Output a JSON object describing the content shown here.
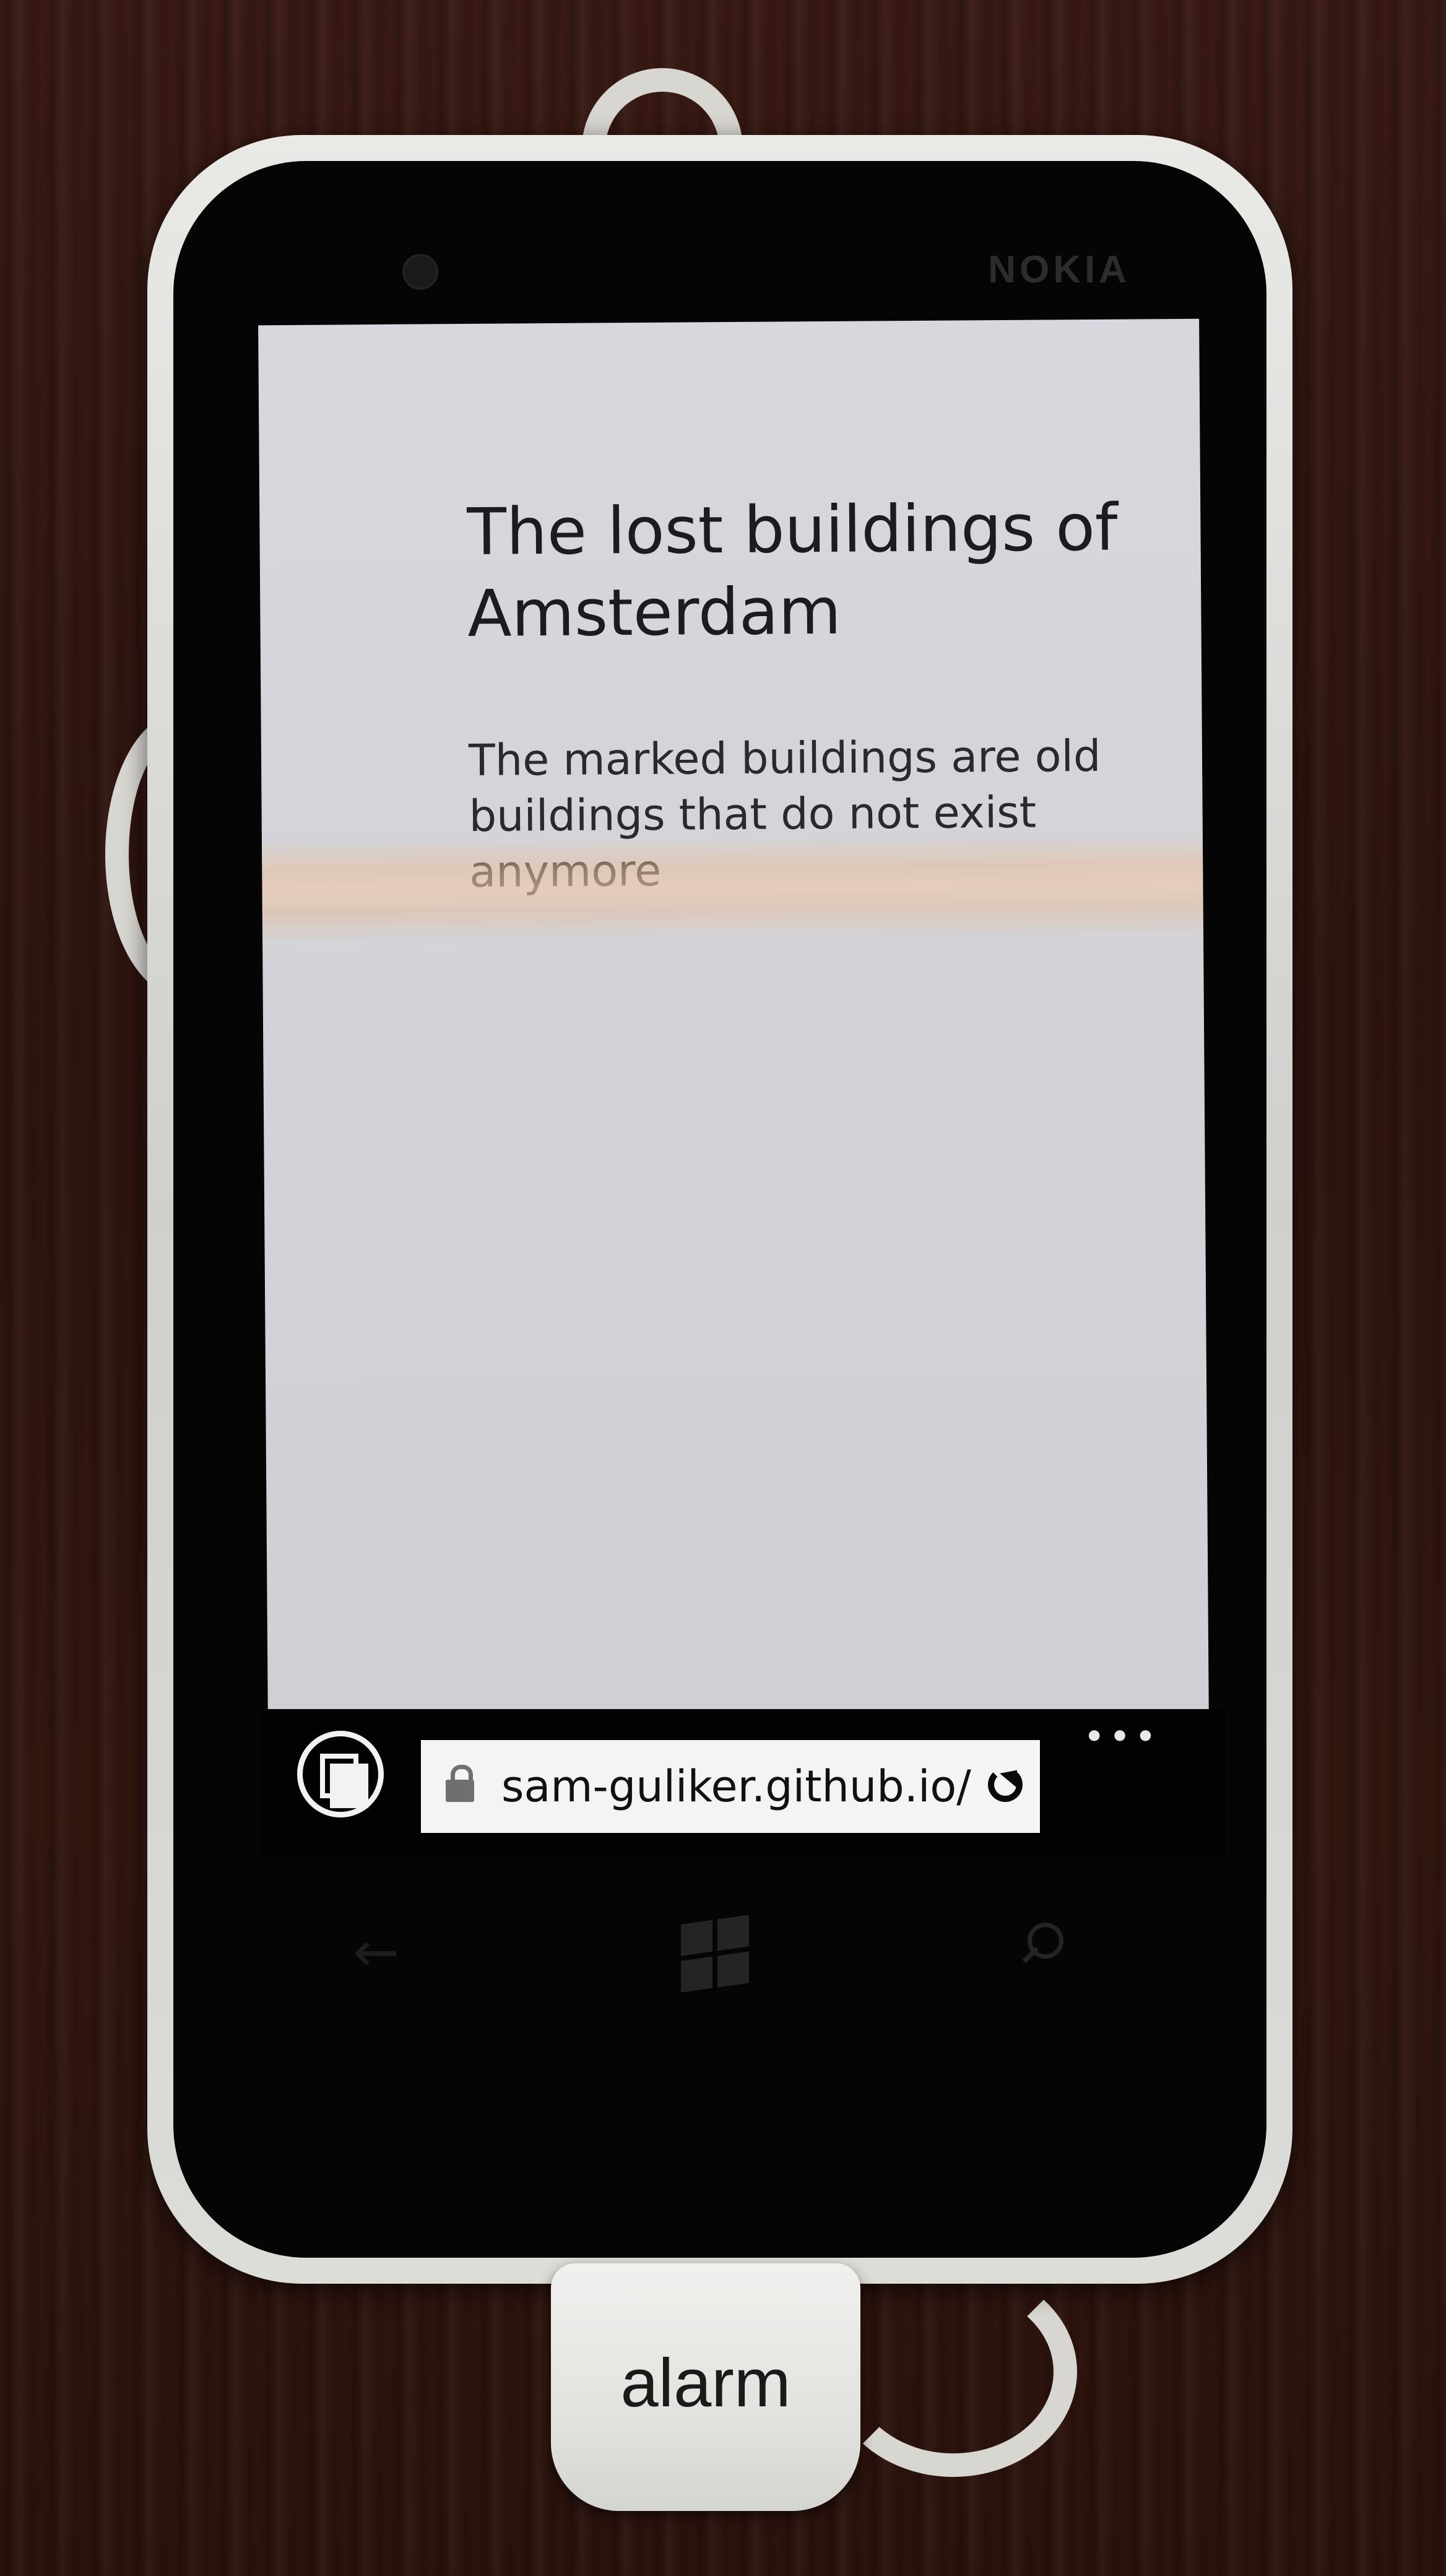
{
  "device": {
    "brand": "NOKIA"
  },
  "page": {
    "title": "The lost buildings of Amsterdam",
    "description": "The marked buildings are old buildings that do not exist anymore"
  },
  "browser": {
    "url": "sam-guliker.github.io/",
    "more_label": "•••",
    "tabs_icon": "tabs-icon",
    "lock_icon": "lock-icon",
    "refresh_icon": "refresh-icon"
  },
  "softkeys": {
    "back_label": "←",
    "icons": [
      "back-arrow-icon",
      "windows-icon",
      "search-icon"
    ]
  },
  "alarm_tag": {
    "label": "alarm"
  }
}
